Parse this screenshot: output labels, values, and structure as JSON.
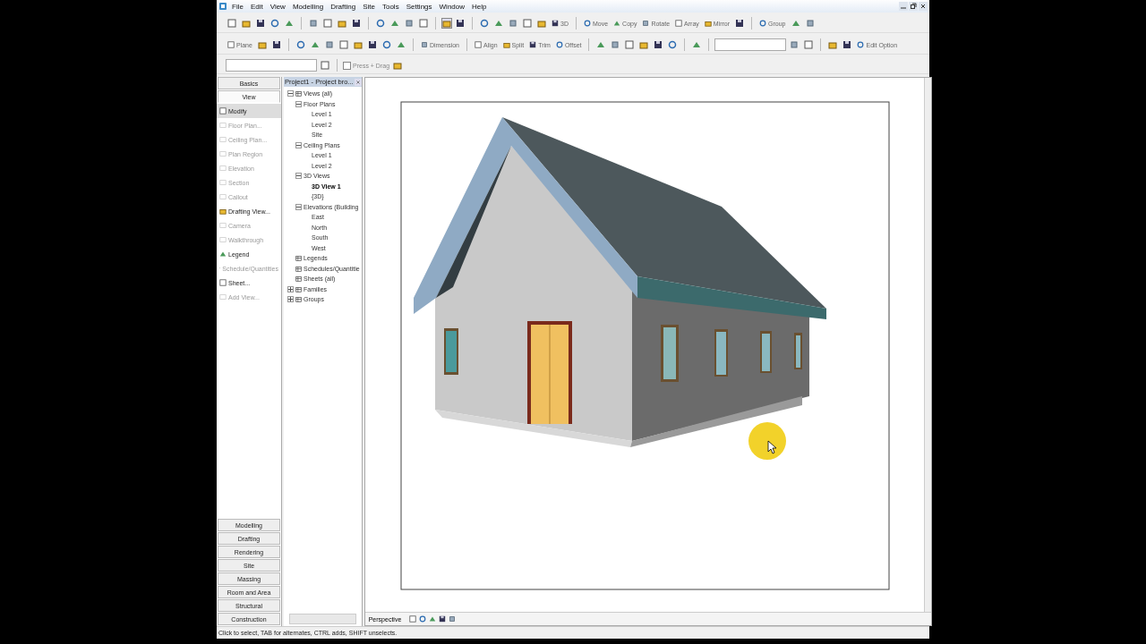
{
  "menu": [
    {
      "label": "File"
    },
    {
      "label": "Edit"
    },
    {
      "label": "View"
    },
    {
      "label": "Modelling"
    },
    {
      "label": "Drafting"
    },
    {
      "label": "Site"
    },
    {
      "label": "Tools"
    },
    {
      "label": "Settings"
    },
    {
      "label": "Window"
    },
    {
      "label": "Help"
    }
  ],
  "toolbars": [
    [
      {
        "kind": "icon"
      },
      {
        "kind": "icon"
      },
      {
        "kind": "icon"
      },
      {
        "kind": "icon"
      },
      {
        "kind": "icon"
      },
      {
        "kind": "sep"
      },
      {
        "kind": "icon"
      },
      {
        "kind": "icon"
      },
      {
        "kind": "icon"
      },
      {
        "kind": "icon"
      },
      {
        "kind": "sep"
      },
      {
        "kind": "icon"
      },
      {
        "kind": "icon"
      },
      {
        "kind": "icon"
      },
      {
        "kind": "icon"
      },
      {
        "kind": "sep"
      },
      {
        "kind": "icon",
        "pressed": true
      },
      {
        "kind": "icon"
      },
      {
        "kind": "sep"
      },
      {
        "kind": "icon"
      },
      {
        "kind": "icon"
      },
      {
        "kind": "icon"
      },
      {
        "kind": "icon"
      },
      {
        "kind": "icon"
      },
      {
        "kind": "button",
        "label": "3D"
      },
      {
        "kind": "sep"
      },
      {
        "kind": "button",
        "label": "Move"
      },
      {
        "kind": "button",
        "label": "Copy"
      },
      {
        "kind": "button",
        "label": "Rotate"
      },
      {
        "kind": "button",
        "label": "Array"
      },
      {
        "kind": "button",
        "label": "Mirror"
      },
      {
        "kind": "icon"
      },
      {
        "kind": "sep"
      },
      {
        "kind": "button",
        "label": "Group"
      },
      {
        "kind": "icon"
      },
      {
        "kind": "icon"
      }
    ],
    [
      {
        "kind": "button",
        "label": "Plane"
      },
      {
        "kind": "icon"
      },
      {
        "kind": "icon"
      },
      {
        "kind": "sep"
      },
      {
        "kind": "icon"
      },
      {
        "kind": "icon"
      },
      {
        "kind": "icon"
      },
      {
        "kind": "icon"
      },
      {
        "kind": "icon"
      },
      {
        "kind": "icon"
      },
      {
        "kind": "icon"
      },
      {
        "kind": "icon"
      },
      {
        "kind": "sep"
      },
      {
        "kind": "button",
        "label": "Dimension"
      },
      {
        "kind": "sep"
      },
      {
        "kind": "button",
        "label": "Align"
      },
      {
        "kind": "button",
        "label": "Split"
      },
      {
        "kind": "button",
        "label": "Trim"
      },
      {
        "kind": "button",
        "label": "Offset"
      },
      {
        "kind": "sep"
      },
      {
        "kind": "icon"
      },
      {
        "kind": "icon"
      },
      {
        "kind": "icon"
      },
      {
        "kind": "icon"
      },
      {
        "kind": "icon"
      },
      {
        "kind": "icon"
      },
      {
        "kind": "sep"
      },
      {
        "kind": "icon"
      },
      {
        "kind": "sep"
      },
      {
        "kind": "combo"
      },
      {
        "kind": "icon"
      },
      {
        "kind": "icon"
      },
      {
        "kind": "sep"
      },
      {
        "kind": "icon"
      },
      {
        "kind": "icon"
      },
      {
        "kind": "button",
        "label": "Edit Option"
      }
    ],
    [
      {
        "kind": "combo"
      },
      {
        "kind": "icon"
      },
      {
        "kind": "sep"
      },
      {
        "kind": "check",
        "label": "Press + Drag",
        "checked": false
      },
      {
        "kind": "icon"
      }
    ]
  ],
  "design_bar": {
    "tabs": [
      {
        "label": "Basics",
        "selected": false
      },
      {
        "label": "View",
        "selected": true
      }
    ],
    "tools": [
      {
        "label": "Modify",
        "disabled": false,
        "selected": true
      },
      {
        "label": "Floor Plan...",
        "disabled": true,
        "selected": false
      },
      {
        "label": "Ceiling Plan...",
        "disabled": true,
        "selected": false
      },
      {
        "label": "Plan Region",
        "disabled": true,
        "selected": false
      },
      {
        "label": "Elevation",
        "disabled": true,
        "selected": false
      },
      {
        "label": "Section",
        "disabled": true,
        "selected": false
      },
      {
        "label": "Callout",
        "disabled": true,
        "selected": false
      },
      {
        "label": "Drafting View...",
        "disabled": false,
        "selected": false
      },
      {
        "label": "Camera",
        "disabled": true,
        "selected": false
      },
      {
        "label": "Walkthrough",
        "disabled": true,
        "selected": false
      },
      {
        "label": "Legend",
        "disabled": false,
        "selected": false
      },
      {
        "label": "Schedule/Quantities",
        "disabled": true,
        "selected": false
      },
      {
        "label": "Sheet...",
        "disabled": false,
        "selected": false
      },
      {
        "label": "Add View...",
        "disabled": true,
        "selected": false
      }
    ],
    "bottom_tabs": [
      {
        "label": "Modelling"
      },
      {
        "label": "Drafting"
      },
      {
        "label": "Rendering"
      },
      {
        "label": "Site"
      },
      {
        "label": "Massing"
      },
      {
        "label": "Room and Area"
      },
      {
        "label": "Structural"
      },
      {
        "label": "Construction"
      }
    ]
  },
  "project_browser": {
    "title": "Project1 - Project bro...",
    "tree": [
      {
        "label": "Views (all)",
        "expanded": true,
        "selected": false,
        "children": [
          {
            "label": "Floor Plans",
            "expanded": true,
            "selected": false,
            "children": [
              {
                "label": "Level 1",
                "selected": false
              },
              {
                "label": "Level 2",
                "selected": false
              },
              {
                "label": "Site",
                "selected": false
              }
            ]
          },
          {
            "label": "Ceiling Plans",
            "expanded": true,
            "selected": false,
            "children": [
              {
                "label": "Level 1",
                "selected": false
              },
              {
                "label": "Level 2",
                "selected": false
              }
            ]
          },
          {
            "label": "3D Views",
            "expanded": true,
            "selected": false,
            "children": [
              {
                "label": "3D View 1",
                "selected": true
              },
              {
                "label": "{3D}",
                "selected": false
              }
            ]
          },
          {
            "label": "Elevations (Building",
            "expanded": true,
            "selected": false,
            "children": [
              {
                "label": "East",
                "selected": false
              },
              {
                "label": "North",
                "selected": false
              },
              {
                "label": "South",
                "selected": false
              },
              {
                "label": "West",
                "selected": false
              }
            ]
          }
        ]
      },
      {
        "label": "Legends",
        "selected": false
      },
      {
        "label": "Schedules/Quantitie",
        "selected": false
      },
      {
        "label": "Sheets (all)",
        "selected": false
      },
      {
        "label": "Families",
        "expanded": false,
        "selected": false
      },
      {
        "label": "Groups",
        "expanded": false,
        "selected": false
      }
    ]
  },
  "view": {
    "view_mode": "Perspective"
  },
  "status_bar": {
    "text": "Click to select, TAB for alternates, CTRL adds, SHIFT unselects."
  }
}
